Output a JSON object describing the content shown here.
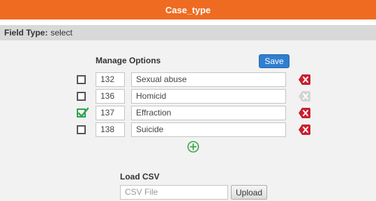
{
  "title": "Case_type",
  "field_type": {
    "label": "Field Type:",
    "value": "select"
  },
  "manage": {
    "heading": "Manage Options",
    "save_label": "Save"
  },
  "options": [
    {
      "id": "132",
      "label": "Sexual abuse",
      "checked": false,
      "delete_enabled": true
    },
    {
      "id": "136",
      "label": "Homicid",
      "checked": false,
      "delete_enabled": false
    },
    {
      "id": "137",
      "label": "Effraction",
      "checked": true,
      "delete_enabled": true
    },
    {
      "id": "138",
      "label": "Suicide",
      "checked": false,
      "delete_enabled": true
    }
  ],
  "add_icon": "plus-circle-icon",
  "csv": {
    "heading": "Load CSV",
    "placeholder": "CSV File",
    "upload_label": "Upload"
  },
  "colors": {
    "title_bar": "#ef6b22",
    "save_button": "#2f7fd0",
    "delete_active": "#c8202f",
    "delete_disabled": "#d4d4d4",
    "check_green": "#2ea44f",
    "add_green": "#3aa84a"
  }
}
